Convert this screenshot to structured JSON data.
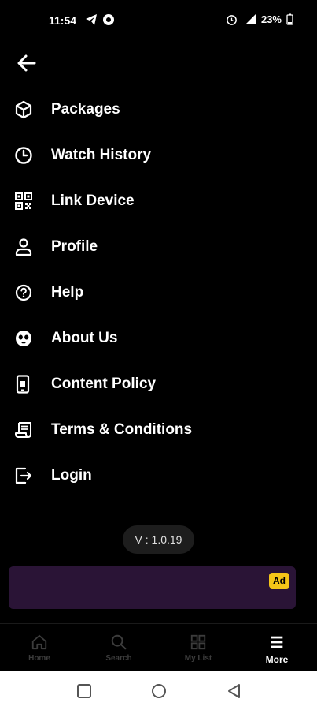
{
  "status_bar": {
    "time": "11:54",
    "battery": "23%"
  },
  "menu": {
    "items": [
      {
        "label": "Packages",
        "icon": "package-icon"
      },
      {
        "label": "Watch History",
        "icon": "clock-icon"
      },
      {
        "label": "Link Device",
        "icon": "qr-code-icon"
      },
      {
        "label": "Profile",
        "icon": "user-icon"
      },
      {
        "label": "Help",
        "icon": "help-circle-icon"
      },
      {
        "label": "About Us",
        "icon": "about-icon"
      },
      {
        "label": "Content Policy",
        "icon": "phone-document-icon"
      },
      {
        "label": "Terms & Conditions",
        "icon": "scroll-icon"
      },
      {
        "label": "Login",
        "icon": "login-icon"
      }
    ]
  },
  "version": "V : 1.0.19",
  "ad": {
    "badge": "Ad"
  },
  "bottom_nav": {
    "items": [
      {
        "label": "Home",
        "icon": "home-icon"
      },
      {
        "label": "Search",
        "icon": "search-icon"
      },
      {
        "label": "My List",
        "icon": "grid-icon"
      },
      {
        "label": "More",
        "icon": "menu-icon"
      }
    ],
    "active": "More"
  }
}
